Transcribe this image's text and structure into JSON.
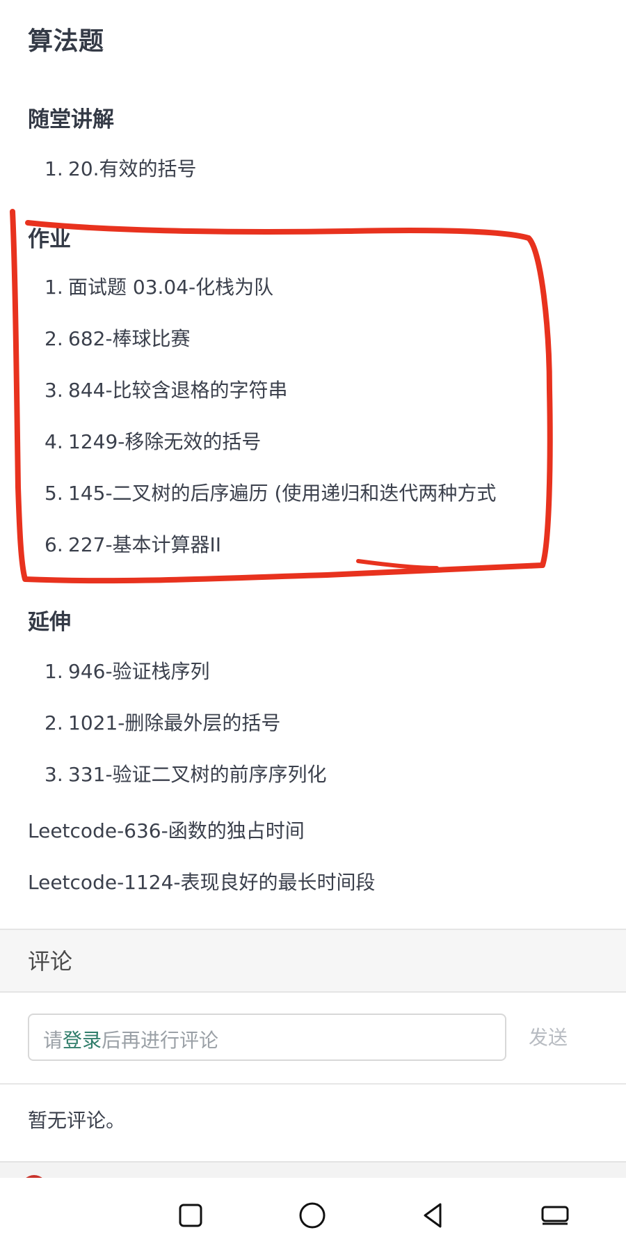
{
  "title": "算法题",
  "sections": {
    "lecture": {
      "heading": "随堂讲解",
      "items": [
        {
          "num": "1.",
          "text": "20.有效的括号"
        }
      ]
    },
    "homework": {
      "heading": "作业",
      "items": [
        {
          "num": "1.",
          "text": "面试题 03.04-化栈为队"
        },
        {
          "num": "2.",
          "text": "682-棒球比赛"
        },
        {
          "num": "3.",
          "text": "844-比较含退格的字符串"
        },
        {
          "num": "4.",
          "text": "1249-移除无效的括号"
        },
        {
          "num": "5.",
          "text": "145-二叉树的后序遍历 (使用递归和迭代两种方式"
        },
        {
          "num": "6.",
          "text": "227-基本计算器II"
        }
      ]
    },
    "extension": {
      "heading": "延伸",
      "items": [
        {
          "num": "1.",
          "text": "946-验证栈序列"
        },
        {
          "num": "2.",
          "text": "1021-删除最外层的括号"
        },
        {
          "num": "3.",
          "text": "331-验证二叉树的前序序列化"
        }
      ],
      "extra": [
        "Leetcode-636-函数的独占时间",
        "Leetcode-1124-表现良好的最长时间段"
      ]
    }
  },
  "comments": {
    "title": "评论",
    "placeholder_before": "请",
    "login_label": "登录",
    "placeholder_after": "后再进行评论",
    "send_label": "发送",
    "empty_text": "暂无评论。"
  },
  "navbar": {
    "buttons": [
      "square-icon",
      "circle-icon",
      "back-triangle-icon",
      "recent-apps-icon"
    ]
  },
  "colors": {
    "annotation": "#e8321e",
    "link": "#2f7d6a"
  }
}
